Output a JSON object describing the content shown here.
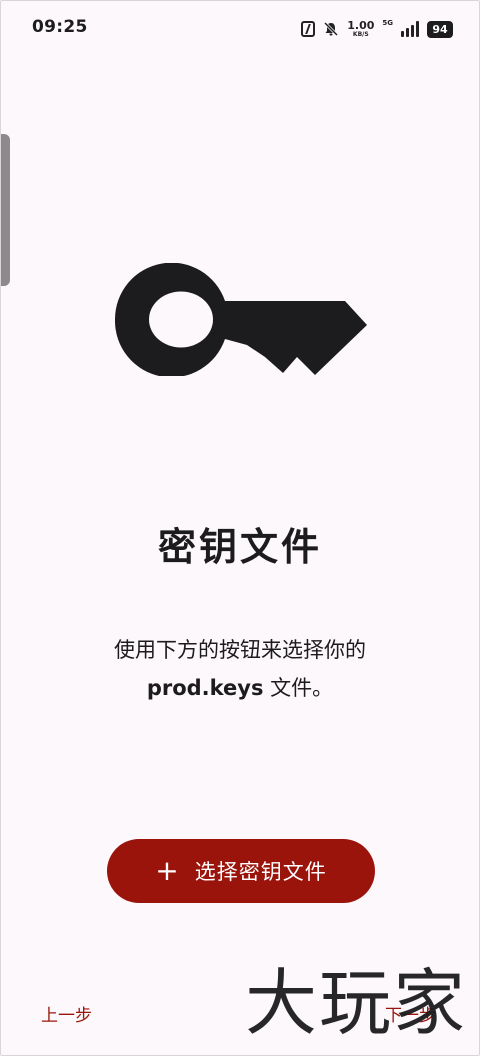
{
  "status_bar": {
    "time": "09:25",
    "speed_value": "1.00",
    "speed_unit": "KB/S",
    "network": "5G",
    "battery": "94",
    "icons": [
      "nfc-icon",
      "bell-off-icon",
      "signal-icon"
    ]
  },
  "main": {
    "icon": "key-icon",
    "title": "密钥文件",
    "description_line1": "使用下方的按钮来选择你的",
    "description_filename": "prod.keys",
    "description_suffix": " 文件。"
  },
  "select_button": {
    "icon": "plus-icon",
    "label": "选择密钥文件"
  },
  "footer": {
    "prev_label": "上一步",
    "next_label": "下一步"
  },
  "watermark": {
    "text": "大玩家"
  },
  "colors": {
    "accent": "#9a140c",
    "background": "#fdf8fb",
    "text": "#1c1b1d"
  }
}
